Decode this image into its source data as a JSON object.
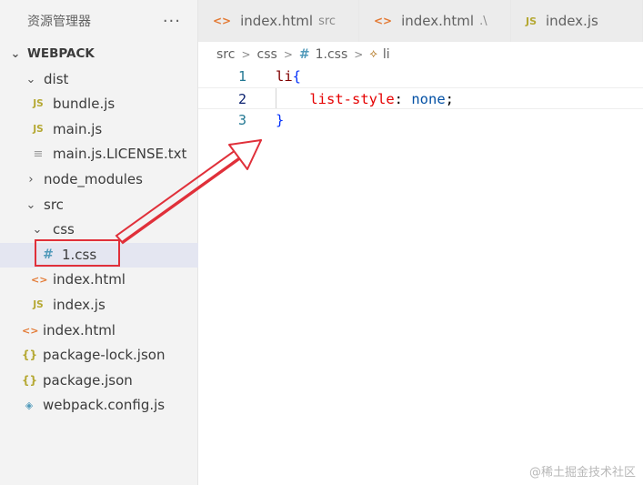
{
  "sidebar": {
    "title": "资源管理器",
    "more_icon": "more-icon",
    "tree": [
      {
        "label": "WEBPACK",
        "type": "root"
      },
      {
        "label": "dist",
        "type": "folder"
      },
      {
        "label": "bundle.js",
        "type": "js"
      },
      {
        "label": "main.js",
        "type": "js"
      },
      {
        "label": "main.js.LICENSE.txt",
        "type": "txt"
      },
      {
        "label": "node_modules",
        "type": "folder-collapsed"
      },
      {
        "label": "src",
        "type": "folder"
      },
      {
        "label": "css",
        "type": "folder"
      },
      {
        "label": "1.css",
        "type": "css",
        "selected": true
      },
      {
        "label": "index.html",
        "type": "html"
      },
      {
        "label": "index.js",
        "type": "js"
      },
      {
        "label": "index.html",
        "type": "html"
      },
      {
        "label": "package-lock.json",
        "type": "json"
      },
      {
        "label": "package.json",
        "type": "json"
      },
      {
        "label": "webpack.config.js",
        "type": "webpack"
      }
    ]
  },
  "tabs": [
    {
      "name": "index.html",
      "desc": "src",
      "icon": "html-file-icon",
      "glyph": "<>"
    },
    {
      "name": "index.html",
      "desc": ".\\",
      "icon": "html-file-icon",
      "glyph": "<>"
    },
    {
      "name": "index.js",
      "desc": "",
      "icon": "js-file-icon",
      "glyph": "JS"
    }
  ],
  "breadcrumb": {
    "items": [
      "src",
      "css",
      "1.css",
      "li"
    ],
    "css_glyph": "#",
    "separator": ">"
  },
  "editor": {
    "lines": [
      {
        "num": "1",
        "selector": "li",
        "open": "{",
        "property": "",
        "value": "",
        "close": ""
      },
      {
        "num": "2",
        "selector": "",
        "open": "",
        "property": "list-style",
        "value": "none",
        "close": ""
      },
      {
        "num": "3",
        "selector": "",
        "open": "",
        "property": "",
        "value": "",
        "close": "}"
      }
    ],
    "current_line": 2
  },
  "icon_glyphs": {
    "js": "JS",
    "html": "<>",
    "css": "#",
    "json": "{}",
    "txt": "≡",
    "webpack": "◈"
  },
  "colors": {
    "annotation_red": "#e0303a",
    "selection_bg": "#e4e6f1",
    "line_number": "#237893"
  },
  "watermark": "@稀土掘金技术社区"
}
